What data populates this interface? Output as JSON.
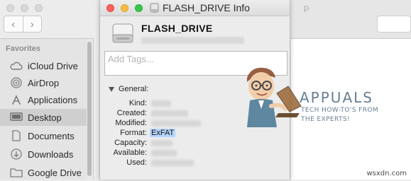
{
  "finder": {
    "back_glyph": "‹",
    "forward_glyph": "›",
    "right_title_fragment": "p",
    "sidebar": {
      "section_title": "Favorites",
      "items": [
        {
          "label": "iCloud Drive",
          "icon": "cloud-icon",
          "selected": false
        },
        {
          "label": "AirDrop",
          "icon": "airdrop-icon",
          "selected": false
        },
        {
          "label": "Applications",
          "icon": "applications-icon",
          "selected": false
        },
        {
          "label": "Desktop",
          "icon": "desktop-icon",
          "selected": true
        },
        {
          "label": "Documents",
          "icon": "documents-icon",
          "selected": false
        },
        {
          "label": "Downloads",
          "icon": "downloads-icon",
          "selected": false
        },
        {
          "label": "Google Drive",
          "icon": "folder-icon",
          "selected": false
        }
      ]
    }
  },
  "info_window": {
    "title": "FLASH_DRIVE Info",
    "drive_name": "FLASH_DRIVE",
    "tags_placeholder": "Add Tags...",
    "general_label": "General:",
    "properties": {
      "kind_label": "Kind:",
      "created_label": "Created:",
      "modified_label": "Modified:",
      "format_label": "Format:",
      "format_value": "ExFAT",
      "capacity_label": "Capacity:",
      "available_label": "Available:",
      "used_label": "Used:"
    }
  },
  "watermark": {
    "brand": "APPUALS",
    "tagline_1": "TECH HOW-TO'S FROM",
    "tagline_2": "THE EXPERTS!",
    "site": "wsxdn.com"
  },
  "colors": {
    "traffic_red": "#fc605c",
    "traffic_yellow": "#fdbc40",
    "traffic_green": "#34c84a",
    "selection_highlight": "#b5d5fb",
    "sidebar_selected": "#cfcfcf"
  }
}
